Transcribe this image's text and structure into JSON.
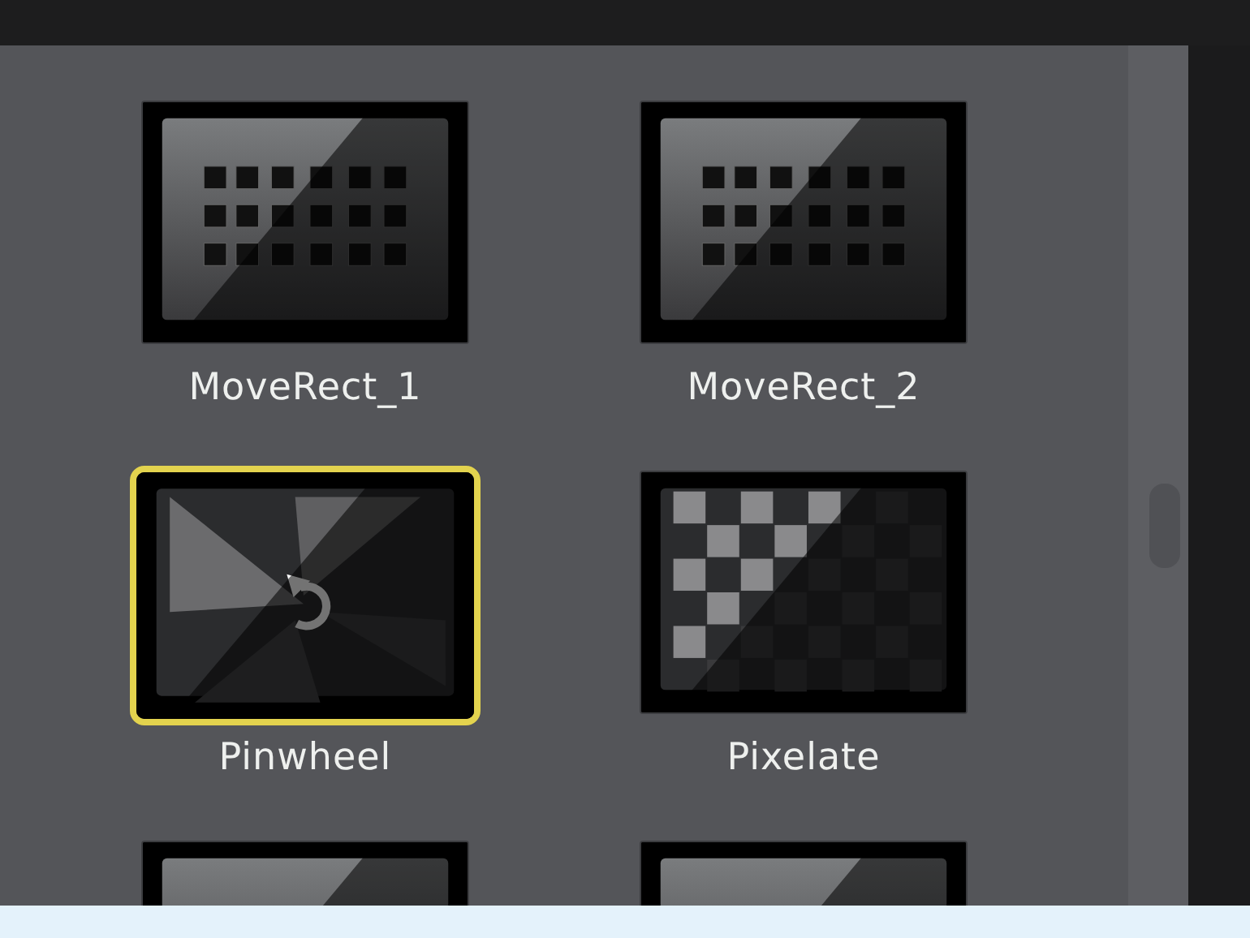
{
  "transitions": [
    {
      "label": "MoveRect_1",
      "kind": "moverect",
      "selected": false
    },
    {
      "label": "MoveRect_2",
      "kind": "moverect",
      "selected": false
    },
    {
      "label": "Pinwheel",
      "kind": "pinwheel",
      "selected": true
    },
    {
      "label": "Pixelate",
      "kind": "pixelate",
      "selected": false
    },
    {
      "kind": "plain",
      "selected": false
    },
    {
      "kind": "plain",
      "selected": false
    }
  ]
}
